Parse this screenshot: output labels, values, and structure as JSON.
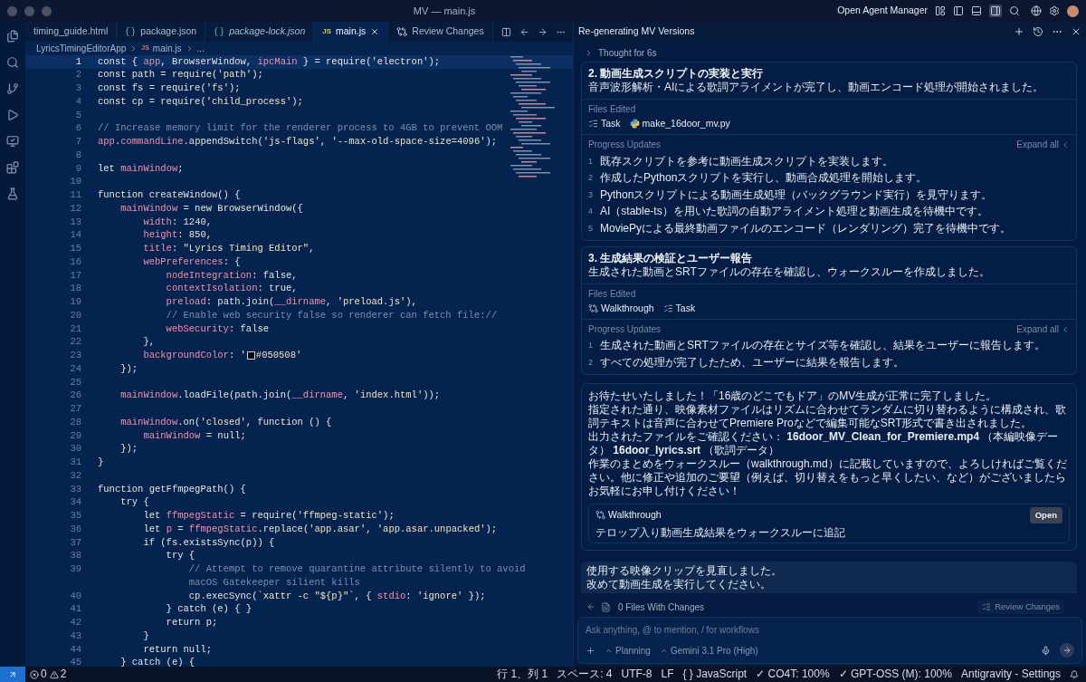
{
  "window": {
    "title": "MV — main.js",
    "agent_manager_label": "Open Agent Manager"
  },
  "tabs": [
    {
      "label": "timing_guide.html",
      "kind": "html",
      "selected": false,
      "preview": false
    },
    {
      "label": "package.json",
      "kind": "json",
      "selected": false,
      "preview": false
    },
    {
      "label": "package-lock.json",
      "kind": "json",
      "selected": false,
      "preview": true
    },
    {
      "label": "main.js",
      "kind": "js",
      "icon_label": "JS",
      "selected": true,
      "preview": false
    },
    {
      "label": "Review Changes",
      "kind": "diff",
      "selected": false,
      "preview": false
    }
  ],
  "breadcrumb": [
    {
      "label": "LyricsTimingEditorApp"
    },
    {
      "label": "main.js",
      "icon_label": "JS"
    },
    {
      "label": "..."
    }
  ],
  "editor": {
    "lines": [
      {
        "number": "1",
        "current": true,
        "tokens": [
          {
            "kind": "plain",
            "text": "const { "
          },
          {
            "kind": "var",
            "text": "app"
          },
          {
            "kind": "plain",
            "text": ", BrowserWindow, "
          },
          {
            "kind": "var",
            "text": "ipcMain"
          },
          {
            "kind": "plain",
            "text": " } = require("
          },
          {
            "kind": "str",
            "text": "'electron'"
          },
          {
            "kind": "plain",
            "text": ");"
          }
        ]
      },
      {
        "number": "2",
        "current": false,
        "tokens": [
          {
            "kind": "plain",
            "text": "const path = require("
          },
          {
            "kind": "str",
            "text": "'path'"
          },
          {
            "kind": "plain",
            "text": ");"
          }
        ]
      },
      {
        "number": "3",
        "current": false,
        "tokens": [
          {
            "kind": "plain",
            "text": "const fs = require("
          },
          {
            "kind": "str",
            "text": "'fs'"
          },
          {
            "kind": "plain",
            "text": ");"
          }
        ]
      },
      {
        "number": "4",
        "current": false,
        "tokens": [
          {
            "kind": "plain",
            "text": "const cp = require("
          },
          {
            "kind": "str",
            "text": "'child_process'"
          },
          {
            "kind": "plain",
            "text": ");"
          }
        ]
      },
      {
        "number": "5",
        "current": false
      },
      {
        "number": "6",
        "current": false,
        "tokens": [
          {
            "kind": "comment",
            "text": "// Increase memory limit for the renderer process to 4GB to prevent OOM"
          }
        ]
      },
      {
        "number": "7",
        "current": false,
        "tokens": [
          {
            "kind": "var",
            "text": "app"
          },
          {
            "kind": "plain",
            "text": "."
          },
          {
            "kind": "var",
            "text": "commandLine"
          },
          {
            "kind": "plain",
            "text": ".appendSwitch("
          },
          {
            "kind": "str",
            "text": "'js-flags'"
          },
          {
            "kind": "plain",
            "text": ", "
          },
          {
            "kind": "str",
            "text": "'--max-old-space-size=4096'"
          },
          {
            "kind": "plain",
            "text": ");"
          }
        ]
      },
      {
        "number": "8",
        "current": false
      },
      {
        "number": "9",
        "current": false,
        "tokens": [
          {
            "kind": "plain",
            "text": "let "
          },
          {
            "kind": "var",
            "text": "mainWindow"
          },
          {
            "kind": "plain",
            "text": ";"
          }
        ]
      },
      {
        "number": "10",
        "current": false
      },
      {
        "number": "11",
        "current": false,
        "tokens": [
          {
            "kind": "plain",
            "text": "function createWindow() {"
          }
        ]
      },
      {
        "number": "12",
        "current": false,
        "tokens": [
          {
            "kind": "var",
            "text": "    mainWindow"
          },
          {
            "kind": "plain",
            "text": " = new BrowserWindow({"
          }
        ]
      },
      {
        "number": "13",
        "current": false,
        "tokens": [
          {
            "kind": "var",
            "text": "        width"
          },
          {
            "kind": "plain",
            "text": ": 1240,"
          }
        ]
      },
      {
        "number": "14",
        "current": false,
        "tokens": [
          {
            "kind": "var",
            "text": "        height"
          },
          {
            "kind": "plain",
            "text": ": 850,"
          }
        ]
      },
      {
        "number": "15",
        "current": false,
        "tokens": [
          {
            "kind": "var",
            "text": "        title"
          },
          {
            "kind": "plain",
            "text": ": "
          },
          {
            "kind": "str",
            "text": "\"Lyrics Timing Editor\""
          },
          {
            "kind": "plain",
            "text": ","
          }
        ]
      },
      {
        "number": "16",
        "current": false,
        "tokens": [
          {
            "kind": "var",
            "text": "        webPreferences"
          },
          {
            "kind": "plain",
            "text": ": {"
          }
        ]
      },
      {
        "number": "17",
        "current": false,
        "tokens": [
          {
            "kind": "var",
            "text": "            nodeIntegration"
          },
          {
            "kind": "plain",
            "text": ": false,"
          }
        ]
      },
      {
        "number": "18",
        "current": false,
        "tokens": [
          {
            "kind": "var",
            "text": "            contextIsolation"
          },
          {
            "kind": "plain",
            "text": ": true,"
          }
        ]
      },
      {
        "number": "19",
        "current": false,
        "tokens": [
          {
            "kind": "var",
            "text": "            preload"
          },
          {
            "kind": "plain",
            "text": ": path.join("
          },
          {
            "kind": "var",
            "text": "__dirname"
          },
          {
            "kind": "plain",
            "text": ", "
          },
          {
            "kind": "str",
            "text": "'preload.js'"
          },
          {
            "kind": "plain",
            "text": "),"
          }
        ]
      },
      {
        "number": "20",
        "current": false,
        "tokens": [
          {
            "kind": "comment",
            "text": "            // Enable web security false so renderer can fetch file://"
          }
        ]
      },
      {
        "number": "21",
        "current": false,
        "tokens": [
          {
            "kind": "var",
            "text": "            webSecurity"
          },
          {
            "kind": "plain",
            "text": ": false"
          }
        ]
      },
      {
        "number": "22",
        "current": false,
        "tokens": [
          {
            "kind": "plain",
            "text": "        },"
          }
        ]
      },
      {
        "number": "23",
        "current": false,
        "tokens": [
          {
            "kind": "var",
            "text": "        backgroundColor"
          },
          {
            "kind": "plain",
            "text": ": "
          },
          {
            "kind": "str",
            "text": "'"
          },
          {
            "kind": "swatch",
            "color": "#050508"
          },
          {
            "kind": "str",
            "text": "#050508'"
          }
        ]
      },
      {
        "number": "24",
        "current": false,
        "tokens": [
          {
            "kind": "plain",
            "text": "    });"
          }
        ]
      },
      {
        "number": "25",
        "current": false
      },
      {
        "number": "26",
        "current": false,
        "tokens": [
          {
            "kind": "var",
            "text": "    mainWindow"
          },
          {
            "kind": "plain",
            "text": ".loadFile(path.join("
          },
          {
            "kind": "var",
            "text": "__dirname"
          },
          {
            "kind": "plain",
            "text": ", "
          },
          {
            "kind": "str",
            "text": "'index.html'"
          },
          {
            "kind": "plain",
            "text": "));"
          }
        ]
      },
      {
        "number": "27",
        "current": false
      },
      {
        "number": "28",
        "current": false,
        "tokens": [
          {
            "kind": "var",
            "text": "    mainWindow"
          },
          {
            "kind": "plain",
            "text": ".on("
          },
          {
            "kind": "str",
            "text": "'closed'"
          },
          {
            "kind": "plain",
            "text": ", function () {"
          }
        ]
      },
      {
        "number": "29",
        "current": false,
        "tokens": [
          {
            "kind": "var",
            "text": "        mainWindow"
          },
          {
            "kind": "plain",
            "text": " = null;"
          }
        ]
      },
      {
        "number": "30",
        "current": false,
        "tokens": [
          {
            "kind": "plain",
            "text": "    });"
          }
        ]
      },
      {
        "number": "31",
        "current": false,
        "tokens": [
          {
            "kind": "plain",
            "text": "}"
          }
        ]
      },
      {
        "number": "32",
        "current": false
      },
      {
        "number": "33",
        "current": false,
        "tokens": [
          {
            "kind": "plain",
            "text": "function getFfmpegPath() {"
          }
        ]
      },
      {
        "number": "34",
        "current": false,
        "tokens": [
          {
            "kind": "plain",
            "text": "    try {"
          }
        ]
      },
      {
        "number": "35",
        "current": false,
        "tokens": [
          {
            "kind": "plain",
            "text": "        let "
          },
          {
            "kind": "var",
            "text": "ffmpegStatic"
          },
          {
            "kind": "plain",
            "text": " = require("
          },
          {
            "kind": "str",
            "text": "'ffmpeg-static'"
          },
          {
            "kind": "plain",
            "text": ");"
          }
        ]
      },
      {
        "number": "36",
        "current": false,
        "tokens": [
          {
            "kind": "plain",
            "text": "        let "
          },
          {
            "kind": "var",
            "text": "p"
          },
          {
            "kind": "plain",
            "text": " = "
          },
          {
            "kind": "var",
            "text": "ffmpegStatic"
          },
          {
            "kind": "plain",
            "text": ".replace("
          },
          {
            "kind": "str",
            "text": "'app.asar'"
          },
          {
            "kind": "plain",
            "text": ", "
          },
          {
            "kind": "str",
            "text": "'app.asar.unpacked'"
          },
          {
            "kind": "plain",
            "text": ");"
          }
        ]
      },
      {
        "number": "37",
        "current": false,
        "tokens": [
          {
            "kind": "plain",
            "text": "        if (fs.existsSync(p)) {"
          }
        ]
      },
      {
        "number": "38",
        "current": false,
        "tokens": [
          {
            "kind": "plain",
            "text": "            try {"
          }
        ]
      },
      {
        "number": "39",
        "current": false,
        "tokens": [
          {
            "kind": "comment",
            "text": "                // Attempt to remove quarantine attribute silently to avoid"
          }
        ]
      },
      {
        "current": false,
        "tokens": [
          {
            "kind": "comment",
            "text": "                macOS Gatekeeper silient kills"
          }
        ]
      },
      {
        "number": "40",
        "current": false,
        "tokens": [
          {
            "kind": "plain",
            "text": "                cp.execSync("
          },
          {
            "kind": "str",
            "text": "`xattr -c \"${p}\"`"
          },
          {
            "kind": "plain",
            "text": ", { "
          },
          {
            "kind": "var",
            "text": "stdio"
          },
          {
            "kind": "plain",
            "text": ": "
          },
          {
            "kind": "str",
            "text": "'ignore'"
          },
          {
            "kind": "plain",
            "text": " });"
          }
        ]
      },
      {
        "number": "41",
        "current": false,
        "tokens": [
          {
            "kind": "plain",
            "text": "            } catch (e) { }"
          }
        ]
      },
      {
        "number": "42",
        "current": false,
        "tokens": [
          {
            "kind": "plain",
            "text": "            return p;"
          }
        ]
      },
      {
        "number": "43",
        "current": false,
        "tokens": [
          {
            "kind": "plain",
            "text": "        }"
          }
        ]
      },
      {
        "number": "44",
        "current": false,
        "tokens": [
          {
            "kind": "plain",
            "text": "        return null;"
          }
        ]
      },
      {
        "number": "45",
        "current": false,
        "tokens": [
          {
            "kind": "plain",
            "text": "    } catch (e) {"
          }
        ]
      }
    ]
  },
  "agent": {
    "title": "Re-generating MV Versions",
    "thought": "Thought for 6s",
    "steps": [
      {
        "title": "2. 動画生成スクリプトの実装と実行",
        "summary": "音声波形解析・AIによる歌詞アライメントが完了し、動画エンコード処理が開始されました。",
        "files_label": "Files Edited",
        "files": [
          {
            "kind": "task",
            "name": "Task"
          },
          {
            "kind": "python",
            "name": "make_16door_mv.py"
          }
        ],
        "progress_label": "Progress Updates",
        "expand_label": "Expand all",
        "updates": [
          {
            "number": "1",
            "text": "既存スクリプトを参考に動画生成スクリプトを実装します。"
          },
          {
            "number": "2",
            "text": "作成したPythonスクリプトを実行し、動画合成処理を開始します。"
          },
          {
            "number": "3",
            "text": "Pythonスクリプトによる動画生成処理（バックグラウンド実行）を見守ります。"
          },
          {
            "number": "4",
            "text": "AI（stable-ts）を用いた歌詞の自動アライメント処理と動画生成を待機中です。"
          },
          {
            "number": "5",
            "text": "MoviePyによる最終動画ファイルのエンコード（レンダリング）完了を待機中です。"
          }
        ]
      },
      {
        "title": "3. 生成結果の検証とユーザー報告",
        "summary": "生成された動画とSRTファイルの存在を確認し、ウォークスルーを作成しました。",
        "files_label": "Files Edited",
        "files": [
          {
            "kind": "walkthrough",
            "name": "Walkthrough"
          },
          {
            "kind": "task",
            "name": "Task"
          }
        ],
        "progress_label": "Progress Updates",
        "expand_label": "Expand all",
        "updates": [
          {
            "number": "1",
            "text": "生成された動画とSRTファイルの存在とサイズ等を確認し、結果をユーザーに報告します。"
          },
          {
            "number": "2",
            "text": "すべての処理が完了したため、ユーザーに結果を報告します。"
          }
        ]
      }
    ],
    "message": {
      "paragraphs": [
        "お待たせいたしました！「16歳のどこでもドア」のMV生成が正常に完了しました。",
        "指定された通り、映像素材ファイルはリズムに合わせてランダムに切り替わるように構成され、歌詞テキストは音声に合わせてPremiere Proなどで編集可能なSRT形式で書き出されました。",
        "出力されたファイルをご確認ください： **16door_MV_Clean_for_Premiere.mp4** （本編映像データ） **16door_lyrics.srt** （歌詞データ）",
        "作業のまとめをウォークスルー（walkthrough.md）に記載していますので、よろしければご覧ください。他に修正や追加のご要望（例えば、切り替えをもっと早くしたい、など）がございましたらお気軽にお申し付けください！"
      ],
      "artifact": {
        "name": "Walkthrough",
        "description": "テロップ入り動画生成結果をウォークスルーに追記",
        "button": "Open"
      }
    },
    "user_message": {
      "lines": [
        "使用する映像クリップを見直しました。",
        "改めて動画生成を実行してください。"
      ]
    },
    "changes_bar": {
      "label": "0 Files With Changes",
      "review_label": "Review Changes"
    },
    "input": {
      "placeholder": "Ask anything, @ to mention, / for workflows",
      "mode": "Planning",
      "model": "Gemini 3.1 Pro (High)"
    }
  },
  "status_bar": {
    "errors": "0",
    "warnings": "2",
    "items": [
      "行 1、列 1",
      "スペース: 4",
      "UTF-8",
      "LF",
      "{ } JavaScript",
      "✓ CO4T: 100%",
      "✓ GPT-OSS (M): 100%",
      "Antigravity - Settings"
    ]
  }
}
